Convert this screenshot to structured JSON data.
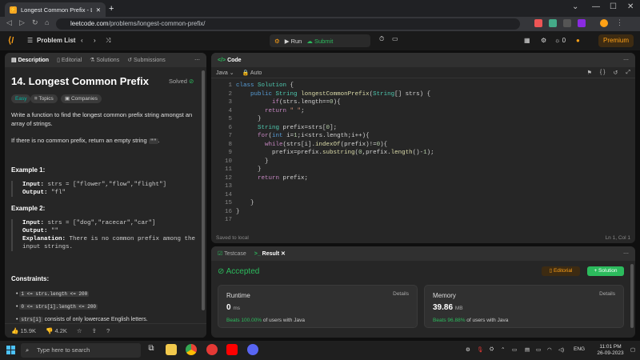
{
  "browser": {
    "tab_title": "Longest Common Prefix - LeetCo",
    "tab_close": "✕",
    "new_tab": "+",
    "url_host": "leetcode.com",
    "url_path": "/problems/longest-common-prefix/"
  },
  "nav": {
    "problem_list": "Problem List",
    "run": "Run",
    "submit": "Submit",
    "streak": "0",
    "premium": "Premium"
  },
  "left": {
    "tabs": [
      "Description",
      "Editorial",
      "Solutions",
      "Submissions"
    ],
    "title": "14. Longest Common Prefix",
    "solved": "Solved",
    "chips": [
      "Easy",
      "Topics",
      "Companies"
    ],
    "desc1": "Write a function to find the longest common prefix string amongst an array of strings.",
    "desc2_pre": "If there is no common prefix, return an empty string ",
    "desc2_code": "\"\"",
    "desc2_post": ".",
    "ex1_title": "Example 1:",
    "ex1_input_label": "Input:",
    "ex1_input": "strs = [\"flower\",\"flow\",\"flight\"]",
    "ex1_output_label": "Output:",
    "ex1_output": "\"fl\"",
    "ex2_title": "Example 2:",
    "ex2_input_label": "Input:",
    "ex2_input": "strs = [\"dog\",\"racecar\",\"car\"]",
    "ex2_output_label": "Output:",
    "ex2_output": "\"\"",
    "ex2_expl_label": "Explanation:",
    "ex2_expl": "There is no common prefix among the input strings.",
    "constraints_title": "Constraints:",
    "constraint1": "1 <= strs.length <= 200",
    "constraint2": "0 <= strs[i].length <= 200",
    "constraint3_code": "strs[i]",
    "constraint3_text": "consists of only lowercase English letters.",
    "likes": "15.9K",
    "dislikes": "4.2K"
  },
  "code": {
    "header": "Code",
    "language": "Java",
    "mode": "Auto",
    "footer_left": "Saved to local",
    "footer_right": "Ln 1, Col 1"
  },
  "result": {
    "tab_testcase": "Testcase",
    "tab_result": "Result",
    "status": "Accepted",
    "editorial": "Editorial",
    "solution": "Solution",
    "runtime_label": "Runtime",
    "runtime_value": "0",
    "runtime_unit": "ms",
    "runtime_beats": "Beats 100.00%",
    "runtime_beats_suffix": "of users with Java",
    "memory_label": "Memory",
    "memory_value": "39.86",
    "memory_unit": "MB",
    "memory_beats": "Beats 96.88%",
    "memory_beats_suffix": "of users with Java",
    "details": "Details"
  },
  "taskbar": {
    "search_placeholder": "Type here to search",
    "lang": "ENG",
    "time": "11:01 PM",
    "date": "26-09-2023"
  },
  "colors": {
    "accent_orange": "#ffa116",
    "accepted_green": "#2cbb5d"
  }
}
